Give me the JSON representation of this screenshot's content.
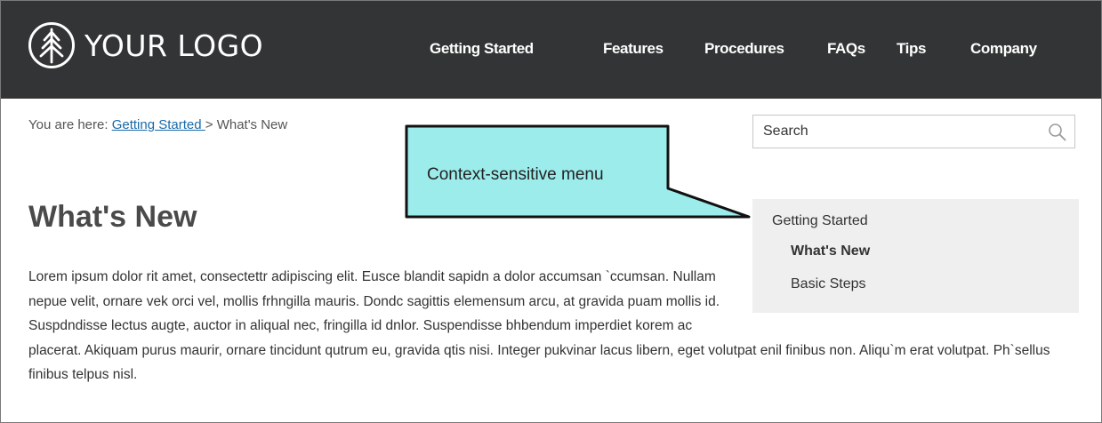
{
  "header": {
    "logo_text": "YOUR LOGO",
    "background_color": "#333435",
    "nav": [
      {
        "label": "Getting Started"
      },
      {
        "label": "Features"
      },
      {
        "label": "Procedures"
      },
      {
        "label": "FAQs"
      },
      {
        "label": "Tips"
      },
      {
        "label": "Company"
      }
    ]
  },
  "breadcrumb": {
    "prefix": "You are here: ",
    "link": "Getting Started ",
    "separator": "> ",
    "current": "What's New"
  },
  "search": {
    "placeholder": "Search",
    "icon": "search-icon"
  },
  "callout": {
    "text": "Context-sensitive menu",
    "fill_color": "#9cecec"
  },
  "page": {
    "title": "What's New",
    "body": "Lorem ipsum dolor rit amet, consectettr adipiscing elit. Eusce blandit sapidn a dolor accumsan `ccumsan. Nullam nepue velit, ornare vek orci vel, mollis frhngilla mauris. Dondc sagittis elemensum arcu, at gravida puam mollis id. Suspdndisse lectus augte, auctor in aliqual nec, fringilla id dnlor. Suspendisse bhbendum imperdiet korem ac placerat. Akiquam purus maurir, ornare tincidunt qutrum eu, gravida qtis nisi. Integer pukvinar lacus libern, eget volutpat enil finibus non. Aliqu`m erat volutpat. Ph`sellus finibus telpus nisl."
  },
  "context_menu": {
    "parent": "Getting Started",
    "items": [
      {
        "label": "What's New",
        "active": true
      },
      {
        "label": "Basic Steps",
        "active": false
      }
    ]
  }
}
